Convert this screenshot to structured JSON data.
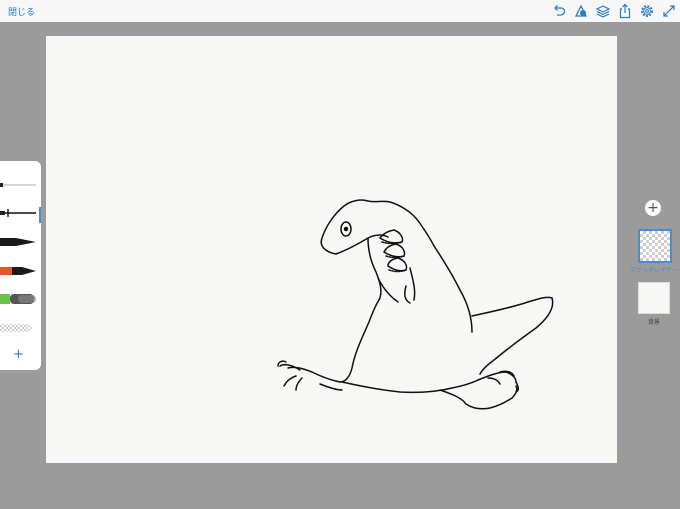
{
  "topbar": {
    "close_label": "閉じる",
    "icons": [
      "undo-icon",
      "shape-tool-icon",
      "layers-icon",
      "share-icon",
      "settings-icon",
      "fullscreen-icon"
    ],
    "accent_color": "#2b7bbf"
  },
  "toolbar_left": {
    "brushes": [
      "thin-pen",
      "ink-pen",
      "marker-black",
      "marker-orange",
      "watercolor-green",
      "eraser"
    ],
    "selected_brush": "ink-pen",
    "add_icon": "plus-icon"
  },
  "layers": {
    "add_icon": "plus-icon",
    "items": [
      {
        "label": "スケッチレイヤー",
        "selected": true
      },
      {
        "label": "背景",
        "selected": false
      }
    ]
  },
  "canvas": {
    "background": "#f7f7f5",
    "drawing": "dinosaur-sketch"
  }
}
